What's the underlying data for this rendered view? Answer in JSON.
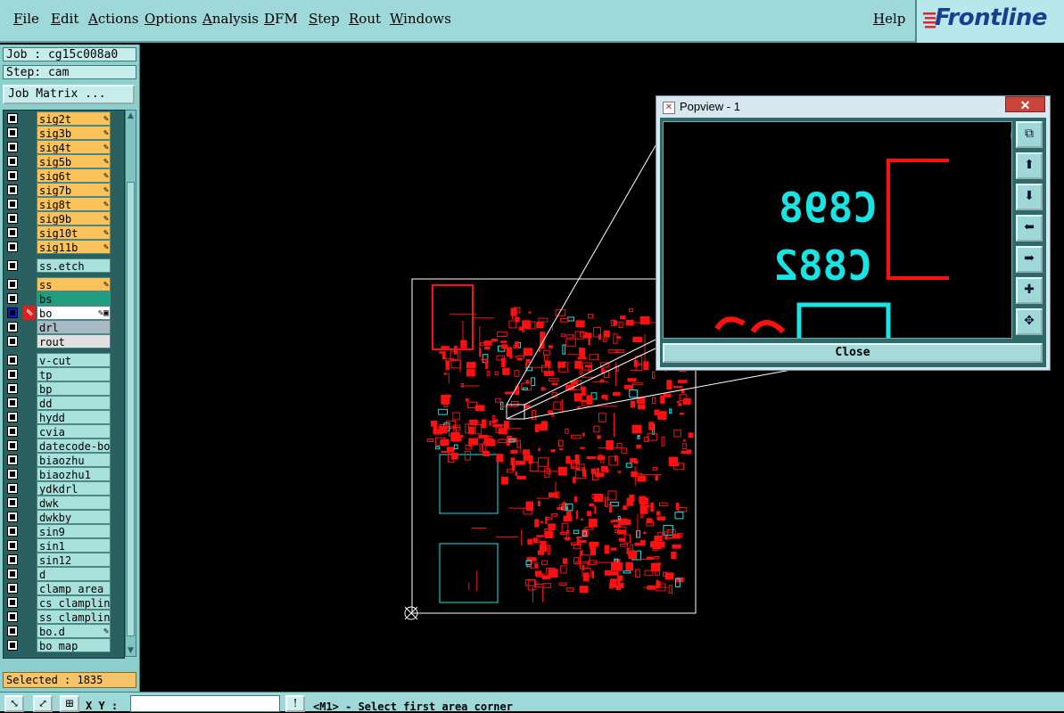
{
  "menu": {
    "items": [
      "File",
      "Edit",
      "Actions",
      "Options",
      "Analysis",
      "DFM",
      "Step",
      "Rout",
      "Windows"
    ],
    "help": "Help",
    "logo": "Frontline"
  },
  "panel": {
    "job": "Job : cg15c008a0",
    "step": "Step: cam",
    "job_matrix": "Job Matrix ...",
    "selected": "Selected : 1835"
  },
  "layers": [
    {
      "name": "sig2t",
      "bg": "#f9c25a",
      "pen": true
    },
    {
      "name": "sig3b",
      "bg": "#f9c25a",
      "pen": true
    },
    {
      "name": "sig4t",
      "bg": "#f9c25a",
      "pen": true
    },
    {
      "name": "sig5b",
      "bg": "#f9c25a",
      "pen": true
    },
    {
      "name": "sig6t",
      "bg": "#f9c25a",
      "pen": true
    },
    {
      "name": "sig7b",
      "bg": "#f9c25a",
      "pen": true
    },
    {
      "name": "sig8t",
      "bg": "#f9c25a",
      "pen": true
    },
    {
      "name": "sig9b",
      "bg": "#f9c25a",
      "pen": true
    },
    {
      "name": "sig10t",
      "bg": "#f9c25a",
      "pen": true
    },
    {
      "name": "sig11b",
      "bg": "#f9c25a",
      "pen": true
    },
    {
      "name": "ss.etch",
      "bg": "#a8e0dc",
      "pen": false
    },
    {
      "name": "ss",
      "bg": "#f9c25a",
      "pen": true
    },
    {
      "name": "bs",
      "bg": "#1e9e7e",
      "pen": false
    },
    {
      "name": "bo",
      "bg": "#ffffff",
      "pen": true,
      "active": true
    },
    {
      "name": "drl",
      "bg": "#a9b9c4",
      "pen": false
    },
    {
      "name": "rout",
      "bg": "#e0e0e0",
      "pen": false
    },
    {
      "name": "v-cut",
      "bg": "#a8e0dc",
      "pen": false
    },
    {
      "name": "tp",
      "bg": "#a8e0dc",
      "pen": false
    },
    {
      "name": "bp",
      "bg": "#a8e0dc",
      "pen": false
    },
    {
      "name": "dd",
      "bg": "#a8e0dc",
      "pen": false
    },
    {
      "name": "hydd",
      "bg": "#a8e0dc",
      "pen": false
    },
    {
      "name": "cvia",
      "bg": "#a8e0dc",
      "pen": false
    },
    {
      "name": "datecode-bo",
      "bg": "#a8e0dc",
      "pen": false
    },
    {
      "name": "biaozhu",
      "bg": "#a8e0dc",
      "pen": false
    },
    {
      "name": "biaozhu1",
      "bg": "#a8e0dc",
      "pen": false
    },
    {
      "name": "ydkdrl",
      "bg": "#a8e0dc",
      "pen": false
    },
    {
      "name": "dwk",
      "bg": "#a8e0dc",
      "pen": false
    },
    {
      "name": "dwkby",
      "bg": "#a8e0dc",
      "pen": false
    },
    {
      "name": "sin9",
      "bg": "#a8e0dc",
      "pen": false
    },
    {
      "name": "sin1",
      "bg": "#a8e0dc",
      "pen": false
    },
    {
      "name": "sin12",
      "bg": "#a8e0dc",
      "pen": false
    },
    {
      "name": "d",
      "bg": "#a8e0dc",
      "pen": false
    },
    {
      "name": "clamp_area",
      "bg": "#a8e0dc",
      "pen": false
    },
    {
      "name": "cs_clampline",
      "bg": "#a8e0dc",
      "pen": false
    },
    {
      "name": "ss_clampline",
      "bg": "#a8e0dc",
      "pen": false
    },
    {
      "name": "bo.d",
      "bg": "#a8e0dc",
      "pen": true
    },
    {
      "name": "bo_map",
      "bg": "#a8e0dc",
      "pen": false
    }
  ],
  "status": {
    "xy_label": "X Y :",
    "xy_value": "",
    "prompt": "<M1> - Select first area corner"
  },
  "popview": {
    "title": "Popview - 1",
    "close_x": "✕",
    "close_button": "Close",
    "label_1": "C898",
    "label_2": "C882"
  },
  "colors": {
    "panel": "#8ccfcc",
    "menubar": "#9fd8d8",
    "signal_layer": "#f9c25a",
    "pcb_red": "#ff1010",
    "pcb_cyan": "#19e3e3"
  }
}
